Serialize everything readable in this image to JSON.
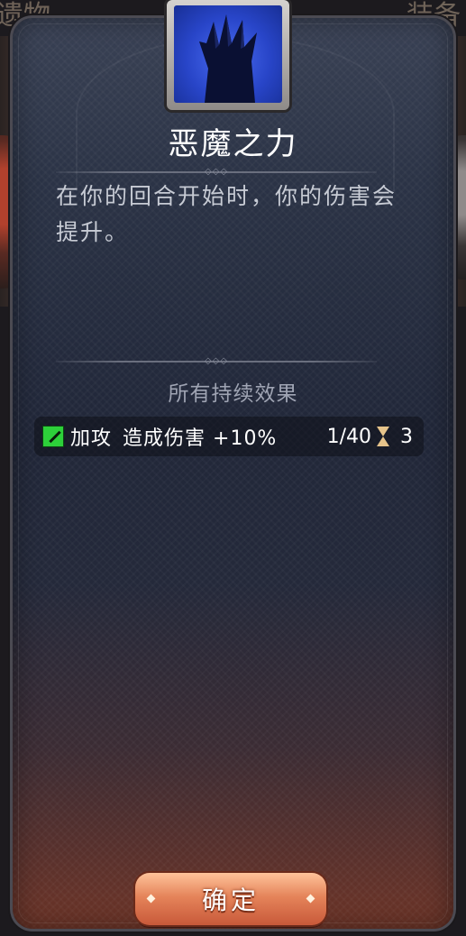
{
  "background": {
    "tab_left": "遗物",
    "tab_right": "装备"
  },
  "dialog": {
    "icon_name": "demon-claw-icon",
    "title": "恶魔之力",
    "description": "在你的回合开始时，你的伤害会提升。",
    "effects_heading": "所有持续效果",
    "effects": [
      {
        "icon": "attack-up-icon",
        "name": "加攻",
        "desc": "造成伤害 +10%",
        "stack": "1/40",
        "turns": "3"
      }
    ],
    "confirm_label": "确定"
  },
  "colors": {
    "panel": "#2b3346",
    "accent_button": "#e5845a",
    "effect_icon": "#2dd03a",
    "hourglass": "#e6c48b",
    "skill_icon": "#2845c8"
  }
}
